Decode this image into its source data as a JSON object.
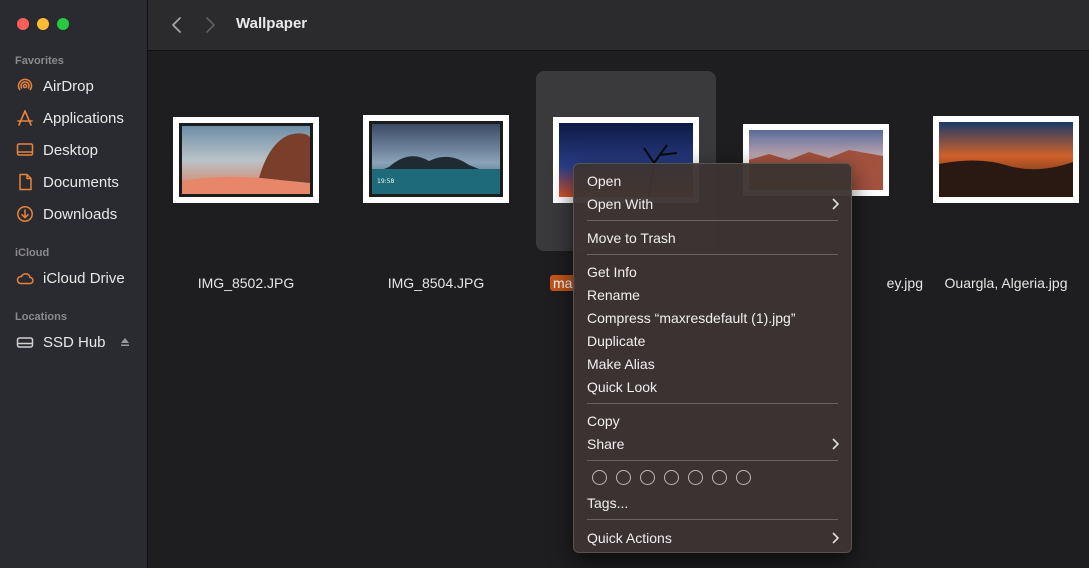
{
  "window": {
    "title": "Wallpaper"
  },
  "sidebar": {
    "sections": [
      {
        "title": "Favorites"
      },
      {
        "title": "iCloud"
      },
      {
        "title": "Locations"
      }
    ],
    "favorites": [
      {
        "label": "AirDrop",
        "icon": "airdrop-icon"
      },
      {
        "label": "Applications",
        "icon": "applications-icon"
      },
      {
        "label": "Desktop",
        "icon": "desktop-icon"
      },
      {
        "label": "Documents",
        "icon": "document-icon"
      },
      {
        "label": "Downloads",
        "icon": "downloads-icon"
      }
    ],
    "icloud": [
      {
        "label": "iCloud Drive",
        "icon": "cloud-icon"
      }
    ],
    "locations": [
      {
        "label": "SSD Hub",
        "icon": "drive-icon"
      }
    ]
  },
  "files": [
    {
      "name": "IMG_8502.JPG"
    },
    {
      "name": "IMG_8504.JPG"
    },
    {
      "name": "maxresdefault (1).jpg",
      "visible_name": "ma",
      "selected": true
    },
    {
      "name": "ey.jpg"
    },
    {
      "name": "Ouargla, Algeria.jpg"
    }
  ],
  "menu": {
    "items": [
      {
        "label": "Open"
      },
      {
        "label": "Open With"
      },
      {
        "label": "Move to Trash"
      },
      {
        "label": "Get Info"
      },
      {
        "label": "Rename"
      },
      {
        "label": "Compress “maxresdefault (1).jpg”"
      },
      {
        "label": "Duplicate"
      },
      {
        "label": "Make Alias"
      },
      {
        "label": "Quick Look"
      },
      {
        "label": "Copy"
      },
      {
        "label": "Share"
      },
      {
        "label": "Tags..."
      },
      {
        "label": "Quick Actions"
      }
    ]
  },
  "colors": {
    "accent": "#e8833a",
    "selection": "#c4551e"
  }
}
